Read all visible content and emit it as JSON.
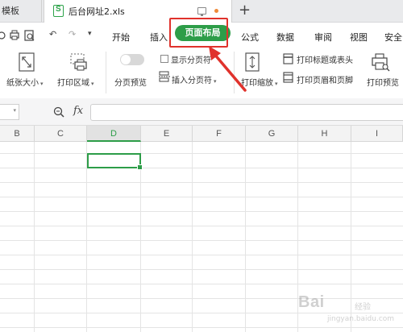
{
  "tabs": {
    "prev_tab": "模板",
    "active_tab": "后台网址2.xls",
    "new_tab": "+"
  },
  "quick_access": {
    "undo": "↶",
    "redo": "↷",
    "more": "▾"
  },
  "menu": {
    "items": [
      "开始",
      "插入",
      "页面布局",
      "公式",
      "数据",
      "审阅",
      "视图",
      "安全"
    ],
    "active": "页面布局"
  },
  "ribbon": {
    "paper_size": "纸张大小",
    "print_area": "打印区域",
    "page_break_preview": "分页预览",
    "show_page_breaks": "显示分页符",
    "insert_page_break": "插入分页符",
    "print_scale": "打印缩放",
    "print_titles": "打印标题或表头",
    "header_footer": "打印页眉和页脚",
    "print_preview": "打印预览"
  },
  "formula_bar": {
    "fx": "fx",
    "value": ""
  },
  "grid": {
    "columns": [
      "B",
      "C",
      "D",
      "E",
      "F",
      "G",
      "H",
      "I"
    ],
    "selected_column": "D"
  },
  "annotation": {
    "highlight_color": "#e0322c",
    "accent": "#2d9d48"
  },
  "watermark": {
    "brand": "Bai",
    "brand2": "经验",
    "url": "jingyan.baidu.com"
  }
}
